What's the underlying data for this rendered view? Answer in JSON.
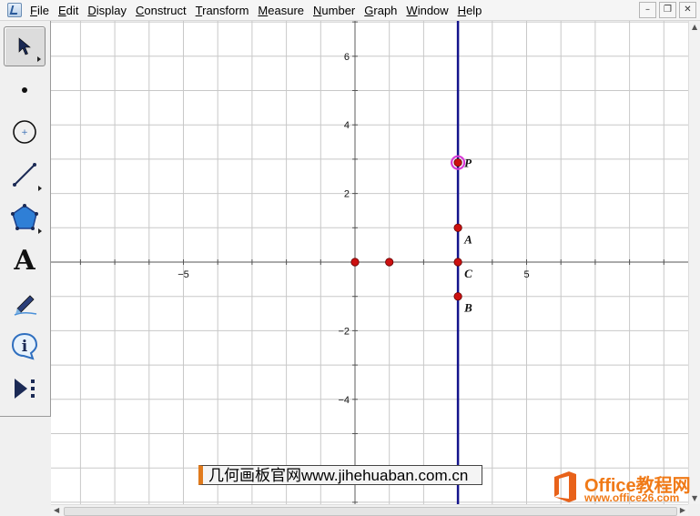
{
  "menu": {
    "items": [
      {
        "label": "File",
        "key": "F",
        "rest": "ile"
      },
      {
        "label": "Edit",
        "key": "E",
        "rest": "dit"
      },
      {
        "label": "Display",
        "key": "D",
        "rest": "isplay"
      },
      {
        "label": "Construct",
        "key": "C",
        "rest": "onstruct"
      },
      {
        "label": "Transform",
        "key": "T",
        "rest": "ransform"
      },
      {
        "label": "Measure",
        "key": "M",
        "rest": "easure"
      },
      {
        "label": "Number",
        "key": "N",
        "rest": "umber"
      },
      {
        "label": "Graph",
        "key": "G",
        "rest": "raph"
      },
      {
        "label": "Window",
        "key": "W",
        "rest": "indow"
      },
      {
        "label": "Help",
        "key": "H",
        "rest": "elp"
      }
    ]
  },
  "toolbox": {
    "tools": [
      "arrow-select",
      "point",
      "compass",
      "straightedge",
      "polygon",
      "text",
      "marker",
      "information",
      "custom-tools"
    ],
    "selected": "arrow-select"
  },
  "graph": {
    "x_ticks": [
      {
        "value": -5,
        "label": "−5"
      },
      {
        "value": 5,
        "label": "5"
      }
    ],
    "y_ticks": [
      {
        "value": 6,
        "label": "6"
      },
      {
        "value": 4,
        "label": "4"
      },
      {
        "value": 2,
        "label": "2"
      },
      {
        "value": -2,
        "label": "−2"
      },
      {
        "value": -4,
        "label": "−4"
      }
    ],
    "vertical_line_x": 3,
    "points": [
      {
        "label": "P",
        "x": 3,
        "y": 2.9,
        "selected": true
      },
      {
        "label": "A",
        "x": 3,
        "y": 1
      },
      {
        "label": "C",
        "x": 3,
        "y": 0
      },
      {
        "label": "B",
        "x": 3,
        "y": -1
      },
      {
        "label": "",
        "x": 0,
        "y": 0
      },
      {
        "label": "",
        "x": 1,
        "y": 0
      }
    ],
    "colors": {
      "line": "#14148c",
      "point": "#cc1111",
      "selection": "#d63ad6",
      "grid": "#c8c8c8"
    }
  },
  "watermarks": {
    "site": "几何画板官网www.jihehuaban.com.cn",
    "office_title": "Office教程网",
    "office_url": "www.office26.com"
  }
}
